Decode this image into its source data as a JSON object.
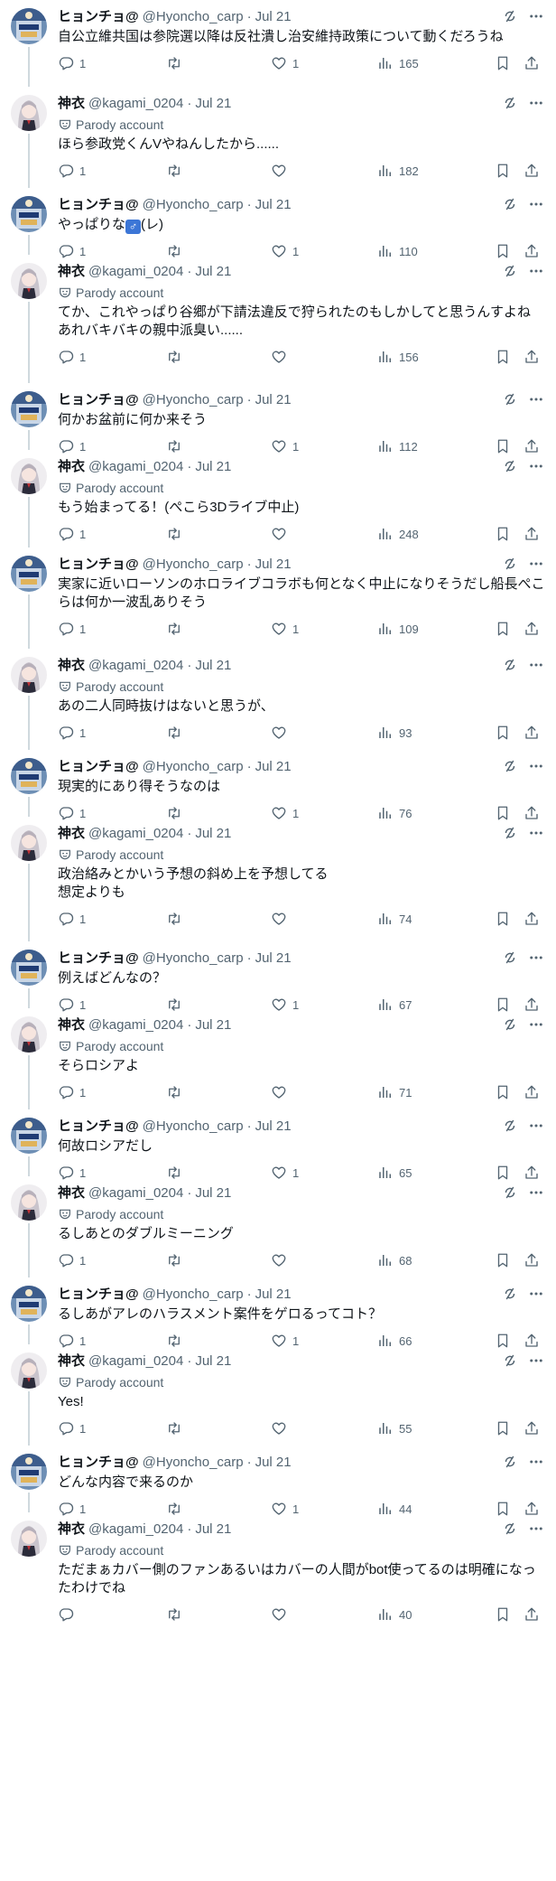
{
  "colors": {
    "text": "#0f1419",
    "secondary": "#536471",
    "thread_line": "#cfd9de",
    "accent": "#1d9bf0"
  },
  "icons": {
    "reply": "reply-icon",
    "retweet": "retweet-icon",
    "like": "heart-icon",
    "views": "views-icon",
    "bookmark": "bookmark-icon",
    "share": "share-icon",
    "grok": "grok-icon",
    "more": "more-icon",
    "parody": "mask-icon"
  },
  "parody_label": "Parody account",
  "tweets": [
    {
      "user": "hyoncho",
      "name": "ヒョンチョ@",
      "handle": "@Hyoncho_carp",
      "sep": "·",
      "date": "Jul 21",
      "text": "自公立維共国は参院選以降は反社潰し治安維持政策について動くだろうね",
      "replies": "1",
      "retweets": "",
      "likes": "1",
      "views": "165"
    },
    {
      "user": "kagami",
      "name": "神衣",
      "handle": "@kagami_0204",
      "sep": "·",
      "date": "Jul 21",
      "text": "ほら参政党くんVやねんしたから......",
      "replies": "1",
      "retweets": "",
      "likes": "",
      "views": "182"
    },
    {
      "user": "hyoncho",
      "name": "ヒョンチョ@",
      "handle": "@Hyoncho_carp",
      "sep": "·",
      "date": "Jul 21",
      "text_pre": "やっぱりな",
      "text_emoji": "♂",
      "text_post": "(レ)",
      "replies": "1",
      "retweets": "",
      "likes": "1",
      "views": "110"
    },
    {
      "user": "kagami",
      "name": "神衣",
      "handle": "@kagami_0204",
      "sep": "·",
      "date": "Jul 21",
      "text": "てか、これやっぱり谷郷が下請法違反で狩られたのもしかしてと思うんすよね\nあれバキバキの親中派臭い......",
      "replies": "1",
      "retweets": "",
      "likes": "",
      "views": "156"
    },
    {
      "user": "hyoncho",
      "name": "ヒョンチョ@",
      "handle": "@Hyoncho_carp",
      "sep": "·",
      "date": "Jul 21",
      "text": "何かお盆前に何か来そう",
      "replies": "1",
      "retweets": "",
      "likes": "1",
      "views": "112"
    },
    {
      "user": "kagami",
      "name": "神衣",
      "handle": "@kagami_0204",
      "sep": "·",
      "date": "Jul 21",
      "text": "もう始まってる！(ぺこら3Dライブ中止)",
      "replies": "1",
      "retweets": "",
      "likes": "",
      "views": "248"
    },
    {
      "user": "hyoncho",
      "name": "ヒョンチョ@",
      "handle": "@Hyoncho_carp",
      "sep": "·",
      "date": "Jul 21",
      "text": "実家に近いローソンのホロライブコラボも何となく中止になりそうだし船長ぺこらは何か一波乱ありそう",
      "replies": "1",
      "retweets": "",
      "likes": "1",
      "views": "109"
    },
    {
      "user": "kagami",
      "name": "神衣",
      "handle": "@kagami_0204",
      "sep": "·",
      "date": "Jul 21",
      "text": "あの二人同時抜けはないと思うが、",
      "replies": "1",
      "retweets": "",
      "likes": "",
      "views": "93"
    },
    {
      "user": "hyoncho",
      "name": "ヒョンチョ@",
      "handle": "@Hyoncho_carp",
      "sep": "·",
      "date": "Jul 21",
      "text": "現実的にあり得そうなのは",
      "replies": "1",
      "retweets": "",
      "likes": "1",
      "views": "76"
    },
    {
      "user": "kagami",
      "name": "神衣",
      "handle": "@kagami_0204",
      "sep": "·",
      "date": "Jul 21",
      "text": "政治絡みとかいう予想の斜め上を予想してる\n想定よりも",
      "replies": "1",
      "retweets": "",
      "likes": "",
      "views": "74"
    },
    {
      "user": "hyoncho",
      "name": "ヒョンチョ@",
      "handle": "@Hyoncho_carp",
      "sep": "·",
      "date": "Jul 21",
      "text": "例えばどんなの？",
      "replies": "1",
      "retweets": "",
      "likes": "1",
      "views": "67"
    },
    {
      "user": "kagami",
      "name": "神衣",
      "handle": "@kagami_0204",
      "sep": "·",
      "date": "Jul 21",
      "text": "そらロシアよ",
      "replies": "1",
      "retweets": "",
      "likes": "",
      "views": "71"
    },
    {
      "user": "hyoncho",
      "name": "ヒョンチョ@",
      "handle": "@Hyoncho_carp",
      "sep": "·",
      "date": "Jul 21",
      "text": "何故ロシアだし",
      "replies": "1",
      "retweets": "",
      "likes": "1",
      "views": "65"
    },
    {
      "user": "kagami",
      "name": "神衣",
      "handle": "@kagami_0204",
      "sep": "·",
      "date": "Jul 21",
      "text": "るしあとのダブルミーニング",
      "replies": "1",
      "retweets": "",
      "likes": "",
      "views": "68"
    },
    {
      "user": "hyoncho",
      "name": "ヒョンチョ@",
      "handle": "@Hyoncho_carp",
      "sep": "·",
      "date": "Jul 21",
      "text": "るしあがアレのハラスメント案件をゲロるってコト？",
      "replies": "1",
      "retweets": "",
      "likes": "1",
      "views": "66"
    },
    {
      "user": "kagami",
      "name": "神衣",
      "handle": "@kagami_0204",
      "sep": "·",
      "date": "Jul 21",
      "text": "Yes!",
      "replies": "1",
      "retweets": "",
      "likes": "",
      "views": "55"
    },
    {
      "user": "hyoncho",
      "name": "ヒョンチョ@",
      "handle": "@Hyoncho_carp",
      "sep": "·",
      "date": "Jul 21",
      "text": "どんな内容で来るのか",
      "replies": "1",
      "retweets": "",
      "likes": "1",
      "views": "44"
    },
    {
      "user": "kagami",
      "name": "神衣",
      "handle": "@kagami_0204",
      "sep": "·",
      "date": "Jul 21",
      "text": "ただまぁカバー側のファンあるいはカバーの人間がbot使ってるのは明確になったわけでね",
      "replies": "",
      "retweets": "",
      "likes": "",
      "views": "40"
    }
  ]
}
